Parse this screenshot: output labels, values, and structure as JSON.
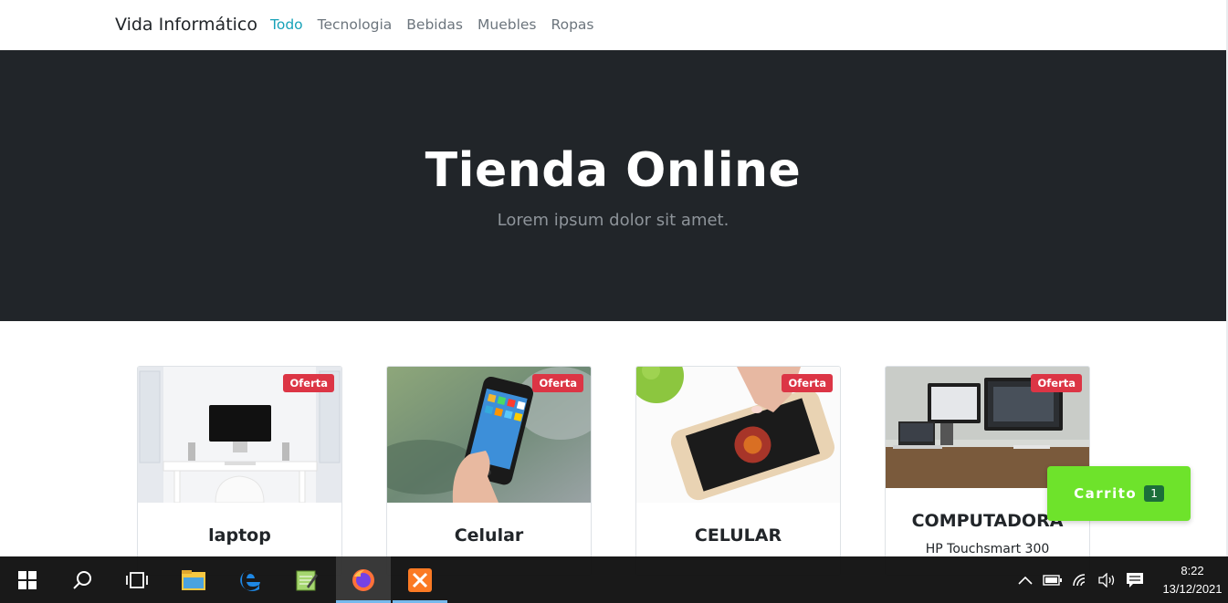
{
  "navbar": {
    "brand": "Vida Informático",
    "links": [
      "Todo",
      "Tecnologia",
      "Bebidas",
      "Muebles",
      "Ropas"
    ],
    "active_index": 0
  },
  "hero": {
    "title": "Tienda Online",
    "subtitle": "Lorem ipsum dolor sit amet."
  },
  "products": [
    {
      "badge": "Oferta",
      "name": "laptop",
      "description": ""
    },
    {
      "badge": "Oferta",
      "name": "Celular",
      "description": ""
    },
    {
      "badge": "Oferta",
      "name": "CELULAR",
      "description": ""
    },
    {
      "badge": "Oferta",
      "name": "COMPUTADORA",
      "description": "HP Touchsmart 300"
    }
  ],
  "cart": {
    "label": "Carrito",
    "count": "1"
  },
  "taskbar": {
    "apps": [
      "windows-start-icon",
      "search-icon",
      "task-view-icon",
      "file-explorer-icon",
      "edge-icon",
      "notepad-icon",
      "firefox-icon",
      "xampp-icon"
    ],
    "clock_time": "8:22",
    "clock_date": "13/12/2021"
  },
  "colors": {
    "accent": "#17a2b8",
    "hero_bg": "#212529",
    "badge": "#dc3545",
    "cart": "#6ee32b"
  }
}
